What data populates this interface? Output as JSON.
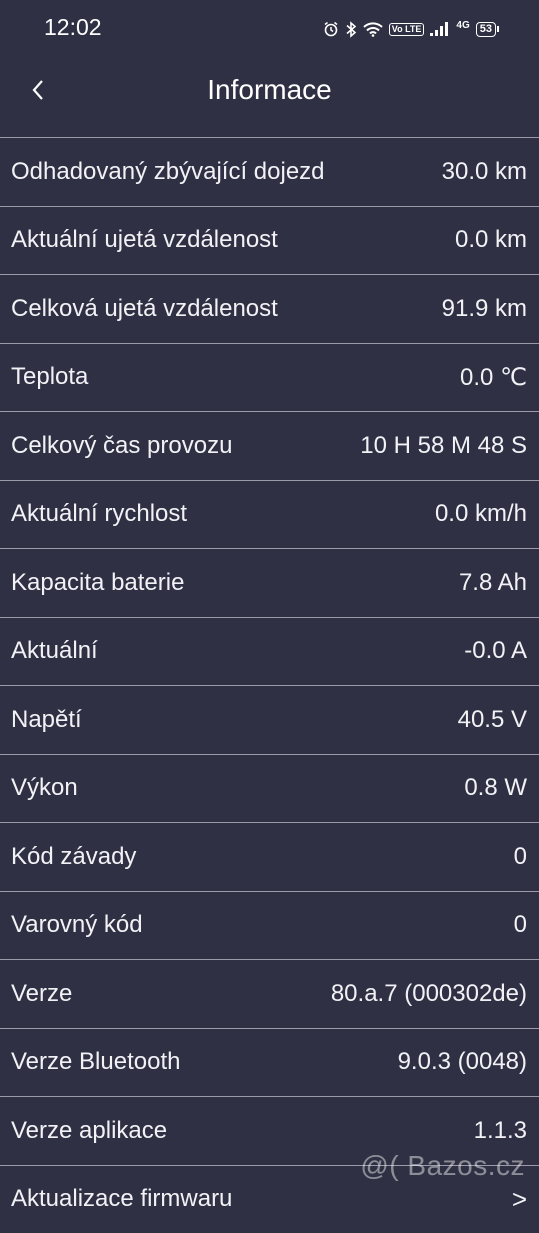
{
  "status_bar": {
    "time": "12:02",
    "volte": "Vo LTE",
    "network": "4G",
    "battery": "53"
  },
  "header": {
    "title": "Informace",
    "back_icon": "chevron-left-icon"
  },
  "rows": [
    {
      "label": "Odhadovaný zbývající dojezd",
      "value": "30.0 km"
    },
    {
      "label": "Aktuální ujetá vzdálenost",
      "value": "0.0 km"
    },
    {
      "label": "Celková ujetá vzdálenost",
      "value": "91.9 km"
    },
    {
      "label": "Teplota",
      "value": "0.0 ℃"
    },
    {
      "label": "Celkový čas provozu",
      "value": "10 H 58 M 48 S"
    },
    {
      "label": "Aktuální rychlost",
      "value": "0.0 km/h"
    },
    {
      "label": "Kapacita baterie",
      "value": "7.8 Ah"
    },
    {
      "label": "Aktuální",
      "value": "-0.0 A"
    },
    {
      "label": "Napětí",
      "value": "40.5 V"
    },
    {
      "label": "Výkon",
      "value": "0.8 W"
    },
    {
      "label": "Kód závady",
      "value": "0"
    },
    {
      "label": "Varovný kód",
      "value": "0"
    },
    {
      "label": "Verze",
      "value": "80.a.7 (000302de)"
    },
    {
      "label": "Verze Bluetooth",
      "value": "9.0.3 (0048)"
    },
    {
      "label": "Verze aplikace",
      "value": "1.1.3"
    },
    {
      "label": "Aktualizace firmwaru",
      "value": ">"
    }
  ],
  "watermark": "@( Bazos.cz",
  "colors": {
    "background": "#2f3043",
    "divider": "#9a9aa8",
    "text": "#f2f2f6"
  }
}
